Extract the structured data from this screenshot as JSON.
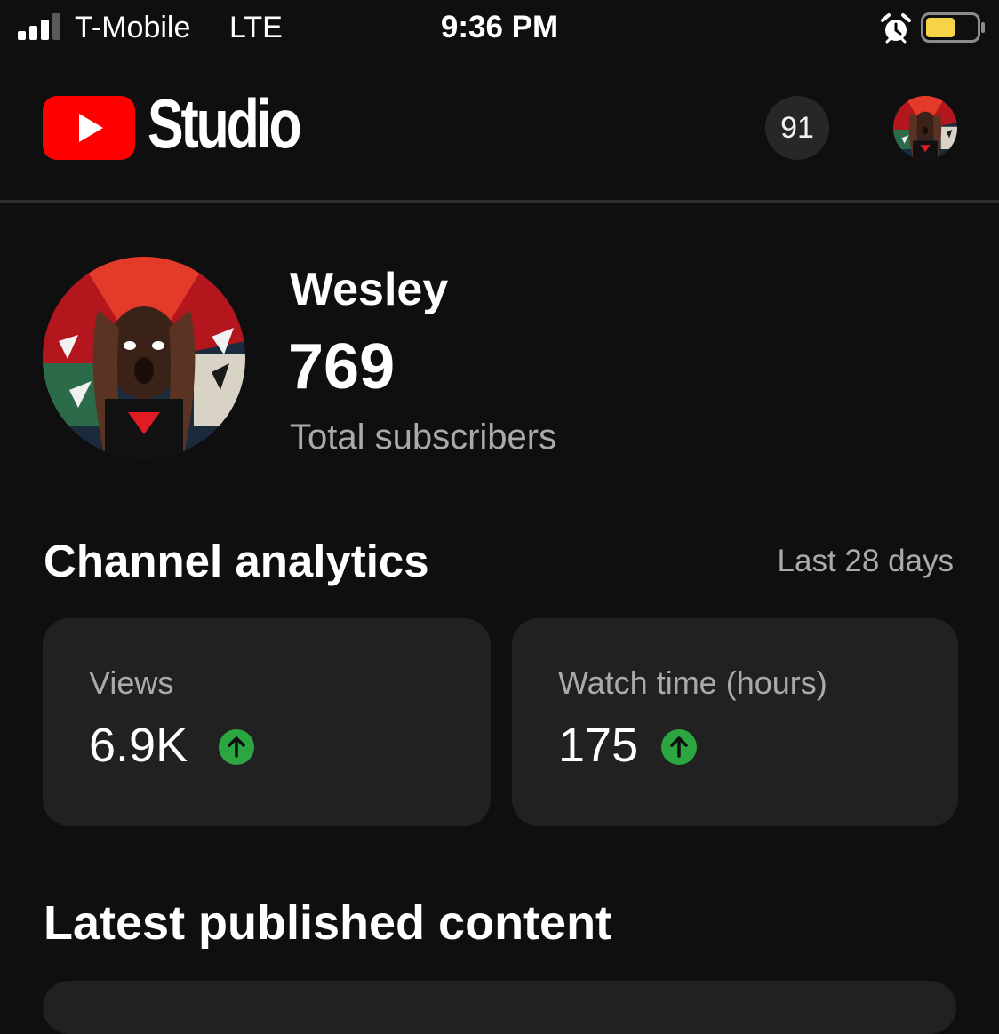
{
  "status_bar": {
    "carrier": "T-Mobile",
    "network": "LTE",
    "time": "9:36 PM",
    "signal_icon": "cellular-signal-icon",
    "alarm_icon": "alarm-clock-icon",
    "battery_icon": "battery-icon",
    "battery_color": "#f5d547"
  },
  "header": {
    "logo_icon": "youtube-play-icon",
    "logo_color": "#ff0000",
    "title": "Studio",
    "notification_count": "91",
    "account_avatar": "profile-avatar"
  },
  "channel": {
    "avatar": "channel-avatar",
    "name": "Wesley",
    "subscribers": "769",
    "subscribers_label": "Total subscribers"
  },
  "analytics": {
    "title": "Channel analytics",
    "period": "Last 28 days",
    "trend_color": "#2ba640",
    "metrics": [
      {
        "label": "Views",
        "value": "6.9K",
        "trend": "up",
        "trend_icon": "arrow-up-icon"
      },
      {
        "label": "Watch time (hours)",
        "value": "175",
        "trend": "up",
        "trend_icon": "arrow-up-icon"
      }
    ]
  },
  "latest": {
    "title": "Latest published content"
  }
}
